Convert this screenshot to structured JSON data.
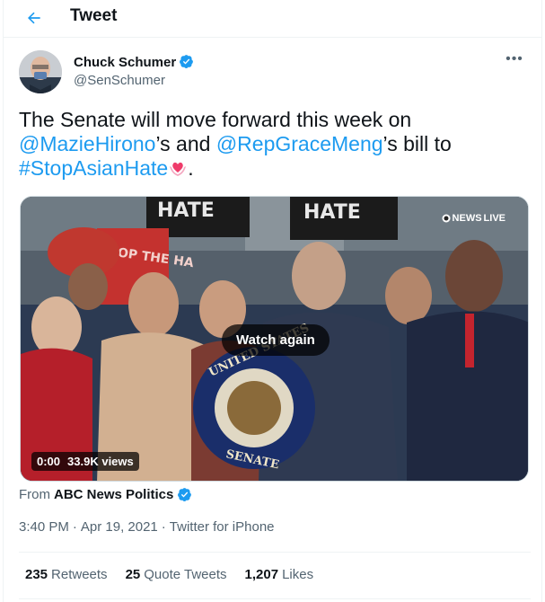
{
  "header": {
    "title": "Tweet",
    "back_icon": "arrow-left-icon"
  },
  "author": {
    "name": "Chuck Schumer",
    "handle": "@SenSchumer",
    "verified": true
  },
  "tweet": {
    "part1": "The Senate will move forward this week on ",
    "mention1": "@MazieHirono",
    "part2": "’s and ",
    "mention2": "@RepGraceMeng",
    "part3": "’s bill to ",
    "hashtag": "#StopAsianHate",
    "part4": "."
  },
  "media": {
    "watch_again": "Watch again",
    "time": "0:00",
    "views": "33.9K views",
    "watermark": "NEWS",
    "watermark_live": "LIVE",
    "sign_text_left": "HATE",
    "sign_text_right": "HATE",
    "poster_text": "TOP THE HA",
    "seal_top": "UNITED STATES",
    "seal_bottom": "SENATE"
  },
  "from": {
    "prefix": "From ",
    "source": "ABC News Politics"
  },
  "meta": {
    "time": "3:40 PM",
    "sep1": "·",
    "date": "Apr 19, 2021",
    "sep2": "·",
    "client": "Twitter for iPhone"
  },
  "stats": {
    "retweets_count": "235",
    "retweets_label": "Retweets",
    "quotes_count": "25",
    "quotes_label": "Quote Tweets",
    "likes_count": "1,207",
    "likes_label": "Likes"
  },
  "colors": {
    "accent": "#1d9bf0",
    "text": "#0f1419",
    "secondary": "#536471"
  }
}
